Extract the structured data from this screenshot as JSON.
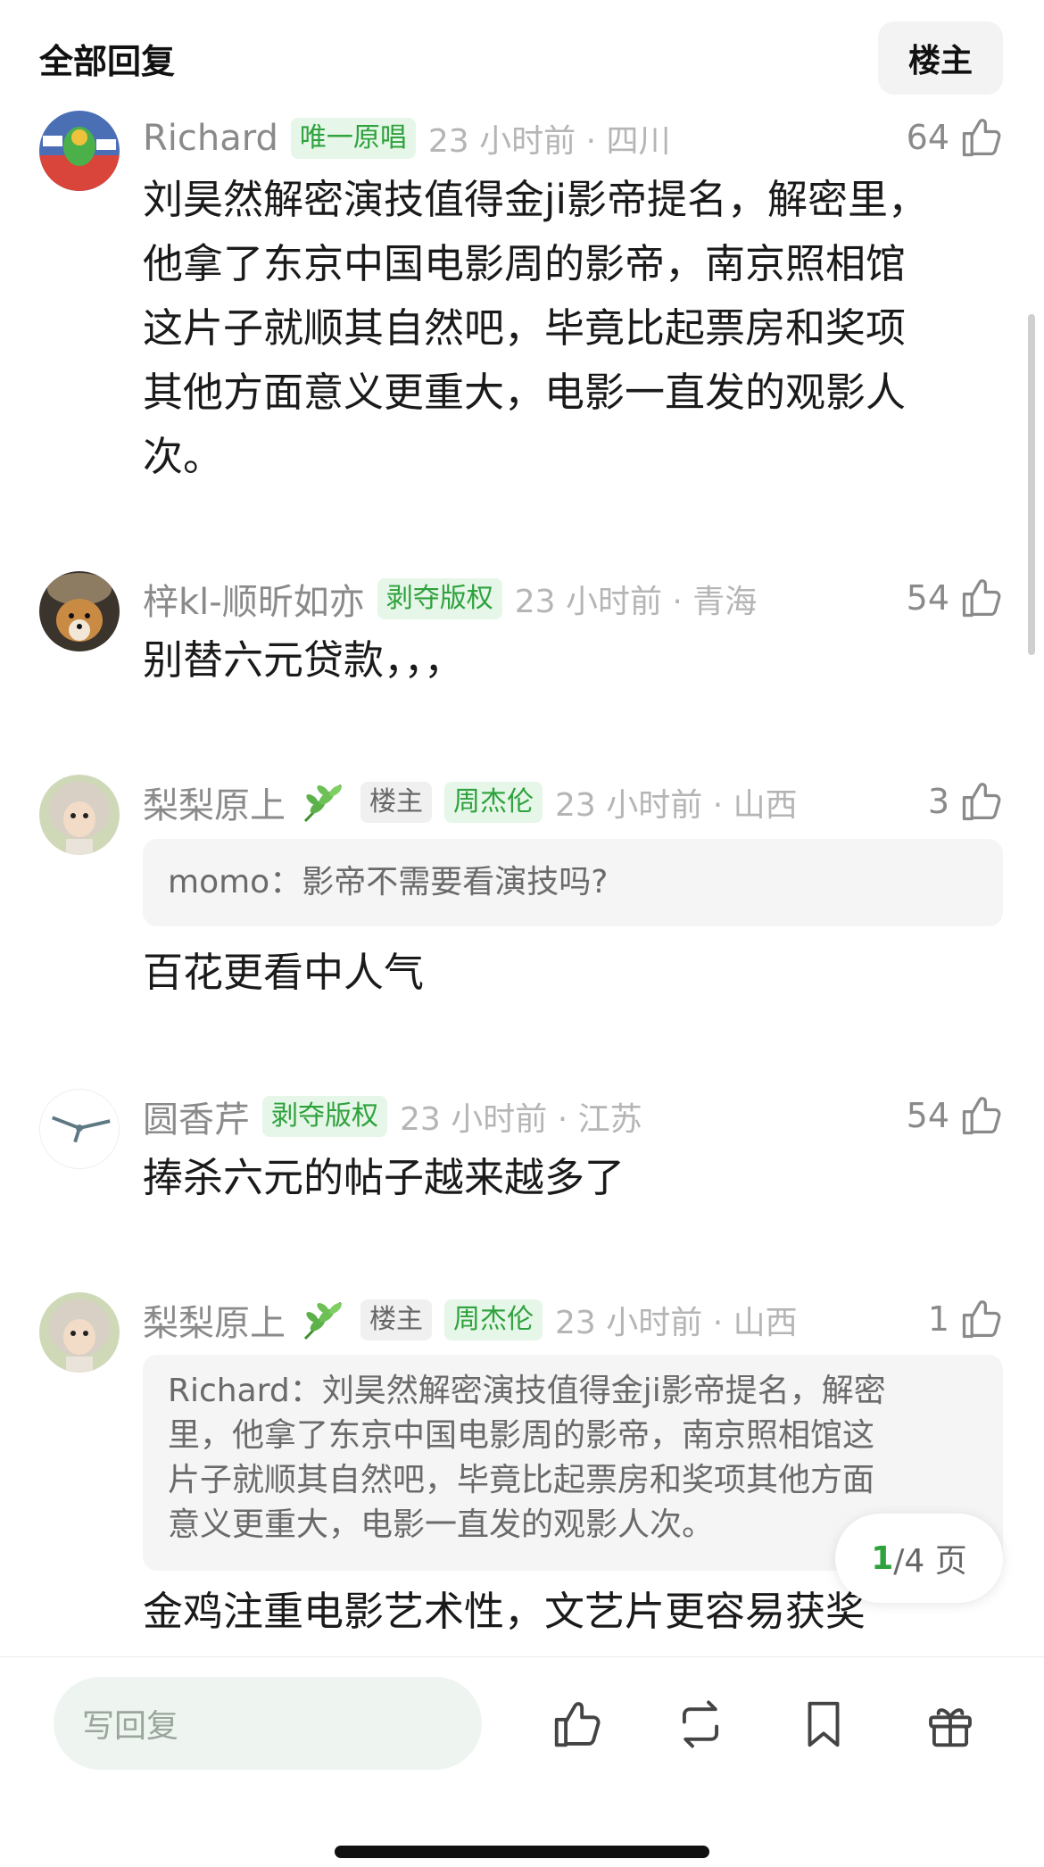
{
  "header": {
    "title": "全部回复",
    "filter_label": "楼主"
  },
  "comments": [
    {
      "name": "Richard",
      "tags": [
        {
          "label": "唯一原唱",
          "style": "green"
        }
      ],
      "time": "23 小时前 · 四川",
      "likes": "64",
      "lines": [
        "刘昊然解密演技值得金ji影帝提名，解密里，",
        "他拿了东京中国电影周的影帝，南京照相馆",
        "这片子就顺其自然吧，毕竟比起票房和奖项",
        "其他方面意义更重大，电影一直发的观影人",
        "次。"
      ]
    },
    {
      "name": "梓kl-顺昕如亦",
      "tags": [
        {
          "label": "剥夺版权",
          "style": "green"
        }
      ],
      "time": "23 小时前 · 青海",
      "likes": "54",
      "lines": [
        "别替六元贷款，，，"
      ]
    },
    {
      "name": "梨梨原上",
      "tags": [
        {
          "label": "楼主",
          "style": "gray"
        },
        {
          "label": "周杰伦",
          "style": "green"
        }
      ],
      "time": "23 小时前 · 山西",
      "likes": "3",
      "quote": [
        "momo：影帝不需要看演技吗?"
      ],
      "lines": [
        "百花更看中人气"
      ]
    },
    {
      "name": "圆香芹",
      "tags": [
        {
          "label": "剥夺版权",
          "style": "green"
        }
      ],
      "time": "23 小时前 · 江苏",
      "likes": "54",
      "lines": [
        "捧杀六元的帖子越来越多了"
      ]
    },
    {
      "name": "梨梨原上",
      "tags": [
        {
          "label": "楼主",
          "style": "gray"
        },
        {
          "label": "周杰伦",
          "style": "green"
        }
      ],
      "time": "23 小时前 · 山西",
      "likes": "1",
      "quote": [
        "Richard：刘昊然解密演技值得金ji影帝提名，解密",
        "里，他拿了东京中国电影周的影帝，南京照相馆这",
        "片子就顺其自然吧，毕竟比起票房和奖项其他方面",
        "意义更重大，电影一直发的观影人次。"
      ],
      "lines": [
        "金鸡注重电影艺术性，文艺片更容易获奖"
      ]
    }
  ],
  "pager": {
    "current": "1",
    "total": "/4 页"
  },
  "bottom_bar": {
    "reply_placeholder": "写回复",
    "icons": [
      "thumbs-up-icon",
      "repost-icon",
      "bookmark-icon",
      "gift-icon"
    ]
  },
  "colors": {
    "accent_green": "#2ea23d",
    "tag_bg_green": "#e6f6e8"
  }
}
